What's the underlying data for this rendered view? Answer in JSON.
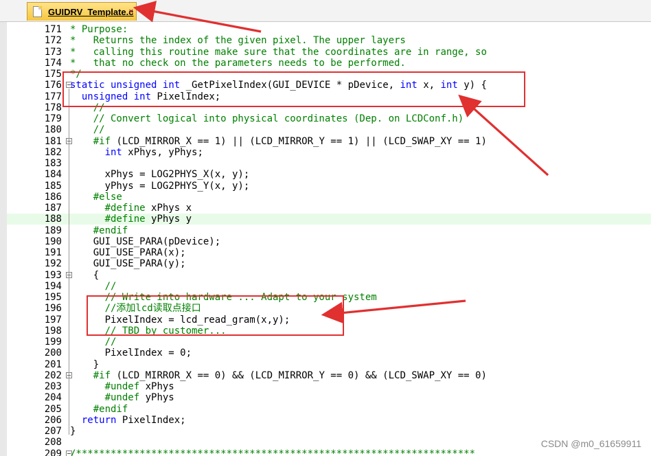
{
  "tab": {
    "title": "GUIDRV_Template.c",
    "close": "×",
    "icon": "c-file-icon"
  },
  "watermark": "CSDN @m0_61659911",
  "lines": [
    {
      "n": "171",
      "code": "* Purpose:"
    },
    {
      "n": "172",
      "code": "*   Returns the index of the given pixel. The upper layers"
    },
    {
      "n": "173",
      "code": "*   calling this routine make sure that the coordinates are in range, so"
    },
    {
      "n": "174",
      "code": "*   that no check on the parameters needs to be performed."
    },
    {
      "n": "175",
      "code": "*/"
    },
    {
      "n": "176",
      "code": "static unsigned int _GetPixelIndex(GUI_DEVICE * pDevice, int x, int y) {"
    },
    {
      "n": "177",
      "code": "  unsigned int PixelIndex;"
    },
    {
      "n": "178",
      "code": "    //"
    },
    {
      "n": "179",
      "code": "    // Convert logical into physical coordinates (Dep. on LCDConf.h)"
    },
    {
      "n": "180",
      "code": "    //"
    },
    {
      "n": "181",
      "code": "    #if (LCD_MIRROR_X == 1) || (LCD_MIRROR_Y == 1) || (LCD_SWAP_XY == 1)"
    },
    {
      "n": "182",
      "code": "      int xPhys, yPhys;"
    },
    {
      "n": "183",
      "code": ""
    },
    {
      "n": "184",
      "code": "      xPhys = LOG2PHYS_X(x, y);"
    },
    {
      "n": "185",
      "code": "      yPhys = LOG2PHYS_Y(x, y);"
    },
    {
      "n": "186",
      "code": "    #else"
    },
    {
      "n": "187",
      "code": "      #define xPhys x"
    },
    {
      "n": "188",
      "code": "      #define yPhys y"
    },
    {
      "n": "189",
      "code": "    #endif"
    },
    {
      "n": "190",
      "code": "    GUI_USE_PARA(pDevice);"
    },
    {
      "n": "191",
      "code": "    GUI_USE_PARA(x);"
    },
    {
      "n": "192",
      "code": "    GUI_USE_PARA(y);"
    },
    {
      "n": "193",
      "code": "    {"
    },
    {
      "n": "194",
      "code": "      //"
    },
    {
      "n": "195",
      "code": "      // Write into hardware ... Adapt to your system"
    },
    {
      "n": "196",
      "code": "      //添加lcd读取点接口"
    },
    {
      "n": "197",
      "code": "      PixelIndex = lcd_read_gram(x,y);"
    },
    {
      "n": "198",
      "code": "      // TBD by customer..."
    },
    {
      "n": "199",
      "code": "      //"
    },
    {
      "n": "200",
      "code": "      PixelIndex = 0;"
    },
    {
      "n": "201",
      "code": "    }"
    },
    {
      "n": "202",
      "code": "    #if (LCD_MIRROR_X == 0) && (LCD_MIRROR_Y == 0) && (LCD_SWAP_XY == 0)"
    },
    {
      "n": "203",
      "code": "      #undef xPhys"
    },
    {
      "n": "204",
      "code": "      #undef yPhys"
    },
    {
      "n": "205",
      "code": "    #endif"
    },
    {
      "n": "206",
      "code": "  return PixelIndex;"
    },
    {
      "n": "207",
      "code": "}"
    },
    {
      "n": "208",
      "code": ""
    },
    {
      "n": "209",
      "code": "/*********************************************************************"
    }
  ],
  "highlighted_line": "188",
  "fold_markers": [
    "176",
    "181",
    "193",
    "202",
    "209"
  ],
  "colors": {
    "comment": "#008000",
    "keyword": "#0000ff",
    "annotation": "#e03030",
    "highlight": "#e8fbe8"
  }
}
